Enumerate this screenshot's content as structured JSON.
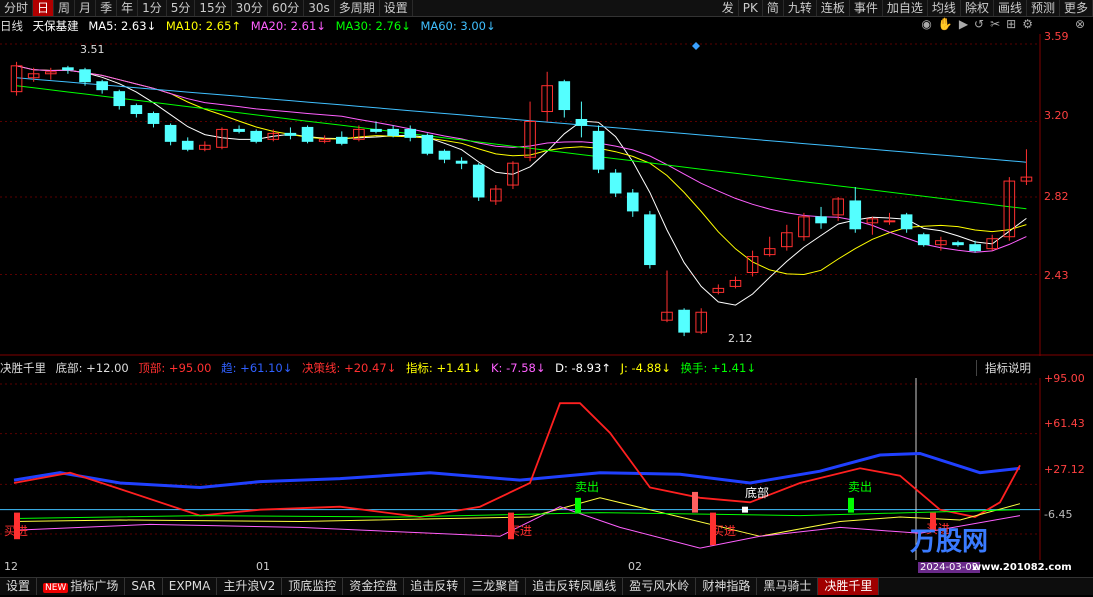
{
  "toolbar": {
    "left": [
      "分时",
      "日",
      "周",
      "月",
      "季",
      "年",
      "1分",
      "5分",
      "15分",
      "30分",
      "60分",
      "30s",
      "多周期",
      "设置"
    ],
    "active_index": 1,
    "right": [
      "发",
      "PK",
      "简",
      "九转",
      "连板",
      "事件",
      "加自选",
      "均线",
      "除权",
      "画线",
      "预测",
      "更多"
    ]
  },
  "info": {
    "period": "日线",
    "stock_name": "天保基建",
    "ma5": "MA5: 2.63↓",
    "ma10": "MA10: 2.65↑",
    "ma20": "MA20: 2.61↓",
    "ma30": "MA30: 2.76↓",
    "ma60": "MA60: 3.00↓"
  },
  "colors": {
    "ma5": "#ffffff",
    "ma10": "#ffff00",
    "ma20": "#ff60ff",
    "ma30": "#00ff00",
    "ma60": "#40c0ff",
    "up": "#ff3030",
    "down": "#54ffff",
    "grid": "#5a0000"
  },
  "price_axis": [
    "3.59",
    "3.20",
    "2.82",
    "2.43"
  ],
  "price_annotations": {
    "high": "3.51",
    "low": "2.12"
  },
  "indicator": {
    "name": "决胜千里",
    "bottom": "底部: +12.00",
    "top": "顶部: +95.00",
    "trend": "趋: +61.10↓",
    "decision": "决策线: +20.47↓",
    "index": "指标: +1.41↓",
    "k": "K: -7.58↓",
    "d": "D: -8.93↑",
    "j": "J: -4.88↓",
    "turnover": "换手: +1.41↓",
    "help": "指标说明",
    "axis": [
      "+95.00",
      "+61.43",
      "+27.12",
      "-6.45"
    ],
    "signals": {
      "buy": "买进",
      "sell": "卖出",
      "bottom": "底部"
    }
  },
  "date_axis": [
    "12",
    "01",
    "02"
  ],
  "bottom_tabs": [
    "设置",
    "指标广场",
    "SAR",
    "EXPMA",
    "主升浪V2",
    "顶底监控",
    "资金控盘",
    "追击反转",
    "三龙聚首",
    "追击反转凤凰线",
    "盈亏风水岭",
    "财神指路",
    "黑马骑士",
    "决胜千里"
  ],
  "bottom_new_badge": "NEW",
  "bottom_active_index": 13,
  "watermark": {
    "brand": "万股网",
    "url": "www.201082.com",
    "date": "2024-03-02"
  },
  "chart_data": {
    "type": "candlestick",
    "ylim": [
      2.05,
      3.62
    ],
    "candles": [
      [
        3.35,
        3.48,
        3.33,
        3.5
      ],
      [
        3.42,
        3.44,
        3.4,
        3.47
      ],
      [
        3.44,
        3.45,
        3.41,
        3.47
      ],
      [
        3.47,
        3.46,
        3.44,
        3.48
      ],
      [
        3.46,
        3.4,
        3.38,
        3.47
      ],
      [
        3.4,
        3.36,
        3.34,
        3.41
      ],
      [
        3.35,
        3.28,
        3.26,
        3.36
      ],
      [
        3.28,
        3.24,
        3.22,
        3.29
      ],
      [
        3.24,
        3.19,
        3.17,
        3.25
      ],
      [
        3.18,
        3.1,
        3.08,
        3.19
      ],
      [
        3.1,
        3.06,
        3.05,
        3.12
      ],
      [
        3.06,
        3.08,
        3.05,
        3.1
      ],
      [
        3.07,
        3.16,
        3.06,
        3.17
      ],
      [
        3.16,
        3.15,
        3.14,
        3.18
      ],
      [
        3.15,
        3.1,
        3.09,
        3.16
      ],
      [
        3.11,
        3.14,
        3.1,
        3.16
      ],
      [
        3.14,
        3.13,
        3.11,
        3.17
      ],
      [
        3.17,
        3.1,
        3.09,
        3.18
      ],
      [
        3.1,
        3.11,
        3.09,
        3.13
      ],
      [
        3.12,
        3.09,
        3.08,
        3.15
      ],
      [
        3.11,
        3.16,
        3.1,
        3.18
      ],
      [
        3.16,
        3.15,
        3.14,
        3.2
      ],
      [
        3.16,
        3.13,
        3.12,
        3.18
      ],
      [
        3.16,
        3.12,
        3.1,
        3.18
      ],
      [
        3.13,
        3.04,
        3.03,
        3.14
      ],
      [
        3.05,
        3.01,
        2.99,
        3.06
      ],
      [
        3.0,
        2.99,
        2.96,
        3.02
      ],
      [
        2.98,
        2.82,
        2.8,
        2.99
      ],
      [
        2.8,
        2.86,
        2.78,
        2.88
      ],
      [
        2.88,
        2.99,
        2.86,
        3.0
      ],
      [
        3.02,
        3.2,
        3.0,
        3.3
      ],
      [
        3.25,
        3.38,
        3.2,
        3.45
      ],
      [
        3.4,
        3.26,
        3.22,
        3.41
      ],
      [
        3.21,
        3.18,
        3.12,
        3.3
      ],
      [
        3.15,
        2.96,
        2.94,
        3.18
      ],
      [
        2.94,
        2.84,
        2.82,
        2.96
      ],
      [
        2.84,
        2.75,
        2.72,
        2.86
      ],
      [
        2.73,
        2.48,
        2.46,
        2.75
      ],
      [
        2.2,
        2.24,
        2.19,
        2.45
      ],
      [
        2.25,
        2.14,
        2.12,
        2.26
      ],
      [
        2.14,
        2.24,
        2.13,
        2.26
      ],
      [
        2.34,
        2.36,
        2.33,
        2.38
      ],
      [
        2.37,
        2.4,
        2.36,
        2.42
      ],
      [
        2.44,
        2.52,
        2.42,
        2.55
      ],
      [
        2.53,
        2.56,
        2.52,
        2.62
      ],
      [
        2.57,
        2.64,
        2.55,
        2.68
      ],
      [
        2.62,
        2.72,
        2.6,
        2.74
      ],
      [
        2.72,
        2.69,
        2.66,
        2.77
      ],
      [
        2.73,
        2.81,
        2.7,
        2.82
      ],
      [
        2.8,
        2.66,
        2.64,
        2.87
      ],
      [
        2.69,
        2.71,
        2.63,
        2.72
      ],
      [
        2.7,
        2.7,
        2.68,
        2.74
      ],
      [
        2.73,
        2.66,
        2.64,
        2.74
      ],
      [
        2.63,
        2.58,
        2.57,
        2.64
      ],
      [
        2.58,
        2.6,
        2.55,
        2.62
      ],
      [
        2.59,
        2.58,
        2.57,
        2.6
      ],
      [
        2.58,
        2.55,
        2.54,
        2.6
      ],
      [
        2.56,
        2.61,
        2.55,
        2.63
      ],
      [
        2.62,
        2.9,
        2.6,
        2.92
      ],
      [
        2.9,
        2.92,
        2.88,
        3.06
      ]
    ]
  }
}
